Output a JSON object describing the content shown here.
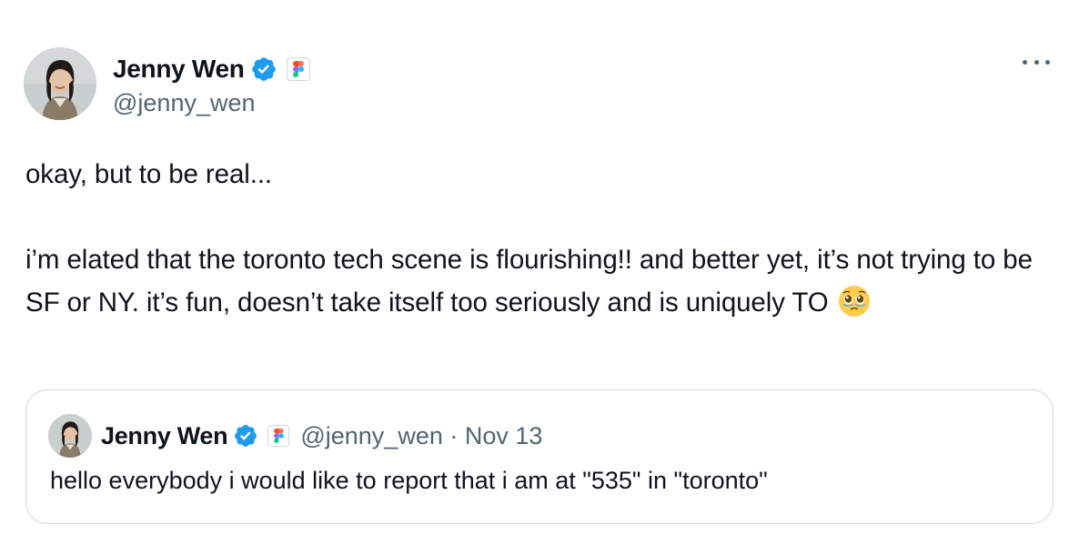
{
  "author": {
    "name": "Jenny Wen",
    "handle": "@jenny_wen",
    "verified": true,
    "affiliation_icon": "figma-logo-icon"
  },
  "more_menu_icon": "more-dots-icon",
  "tweet": {
    "paragraph_1": "okay, but to be real...",
    "paragraph_2": "i’m elated that the toronto tech scene is flourishing!! and better yet, it’s not trying to be SF or NY. it’s fun, doesn’t take itself too seriously and is uniquely TO",
    "emoji": "face-holding-back-tears-emoji"
  },
  "quoted_tweet": {
    "author_name": "Jenny Wen",
    "handle": "@jenny_wen",
    "separator": "·",
    "date": "Nov 13",
    "text": "hello everybody i would like to report that i am at \"535\" in \"toronto\""
  },
  "colors": {
    "verified_blue": "#1d9bf0",
    "secondary_text": "#536471",
    "border": "#cfd9de",
    "primary_text": "#0f1419"
  }
}
